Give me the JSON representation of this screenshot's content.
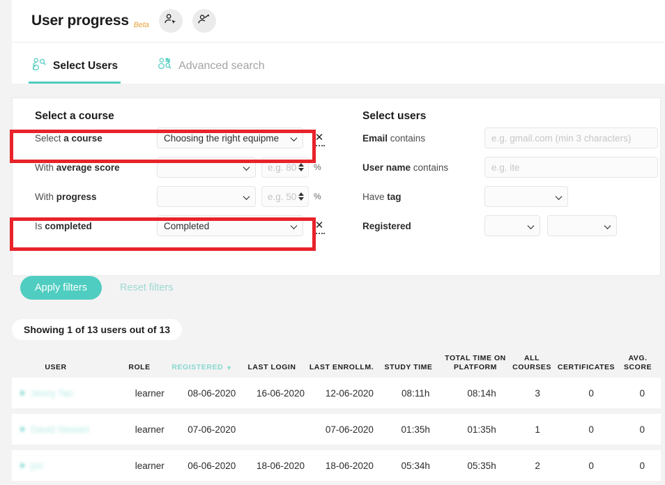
{
  "header": {
    "title": "User progress",
    "beta": "Beta",
    "icons": [
      {
        "name": "user-select-icon",
        "glyph": "person-cursor"
      },
      {
        "name": "user-progress-icon",
        "glyph": "person-arrow"
      }
    ]
  },
  "tabs": [
    {
      "label": "Select Users",
      "icon": "users-search-icon",
      "active": true
    },
    {
      "label": "Advanced search",
      "icon": "users-filter-search-icon",
      "active": false
    }
  ],
  "filters": {
    "course_panel": {
      "title": "Select a course",
      "rows": [
        {
          "label_plain": "Select ",
          "label_bold": "a course",
          "value": "Choosing the right equipme",
          "clear": "✕",
          "highlighted": true
        },
        {
          "label_plain": "With ",
          "label_bold": "average score",
          "value": "",
          "number_placeholder": "e.g. 80",
          "unit": "%"
        },
        {
          "label_plain": "With ",
          "label_bold": "progress",
          "value": "",
          "number_placeholder": "e.g. 50",
          "unit": "%"
        },
        {
          "label_plain": "Is ",
          "label_bold": "completed",
          "value": "Completed",
          "clear": "✕",
          "highlighted": true
        }
      ]
    },
    "users_panel": {
      "title": "Select users",
      "rows": [
        {
          "label_plain": "",
          "label_bold": "Email",
          "label_tail": " contains",
          "placeholder": "e.g. gmail.com (min 3 characters)",
          "value": ""
        },
        {
          "label_plain": "",
          "label_bold": "User name",
          "label_tail": " contains",
          "placeholder": "e.g. ite",
          "value": ""
        },
        {
          "label_plain": "Have ",
          "label_bold": "tag",
          "label_tail": "",
          "value": ""
        },
        {
          "label_plain": "",
          "label_bold": "Registered",
          "label_tail": "",
          "value": "",
          "value2": ""
        }
      ]
    }
  },
  "actions": {
    "apply_label": "Apply filters",
    "reset_label": "Reset filters"
  },
  "results": {
    "showing": "Showing 1 of 13 users out of 13",
    "columns": [
      {
        "label": "USER",
        "sorted": false
      },
      {
        "label": "ROLE",
        "sorted": false
      },
      {
        "label": "REGISTERED",
        "sorted": true,
        "caret": "▼"
      },
      {
        "label": "LAST LOGIN",
        "sorted": false
      },
      {
        "label": "LAST ENROLLM.",
        "sorted": false
      },
      {
        "label": "STUDY TIME",
        "sorted": false
      },
      {
        "label": "TOTAL TIME ON PLATFORM",
        "sorted": false
      },
      {
        "label": "ALL COURSES",
        "sorted": false
      },
      {
        "label": "CERTIFICATES",
        "sorted": false
      },
      {
        "label": "AVG. SCORE",
        "sorted": false
      }
    ],
    "rows": [
      {
        "user": "Jenny Tan",
        "role": "learner",
        "registered": "08-06-2020",
        "last_login": "16-06-2020",
        "last_enrollment": "12-06-2020",
        "study_time": "08:11h",
        "total_time": "08:14h",
        "all_courses": "3",
        "certificates": "0",
        "avg_score": "0"
      },
      {
        "user": "David Stewart",
        "role": "learner",
        "registered": "07-06-2020",
        "last_login": "",
        "last_enrollment": "07-06-2020",
        "study_time": "01:35h",
        "total_time": "01:35h",
        "all_courses": "1",
        "certificates": "0",
        "avg_score": "0"
      },
      {
        "user": "jon",
        "role": "learner",
        "registered": "06-06-2020",
        "last_login": "18-06-2020",
        "last_enrollment": "18-06-2020",
        "study_time": "05:34h",
        "total_time": "05:35h",
        "all_courses": "2",
        "certificates": "0",
        "avg_score": "0"
      }
    ]
  },
  "colors": {
    "accent": "#4ecdc0",
    "annotation": "#e8232a",
    "beta": "#e8a33d",
    "page_bg": "#f3f3f3"
  }
}
